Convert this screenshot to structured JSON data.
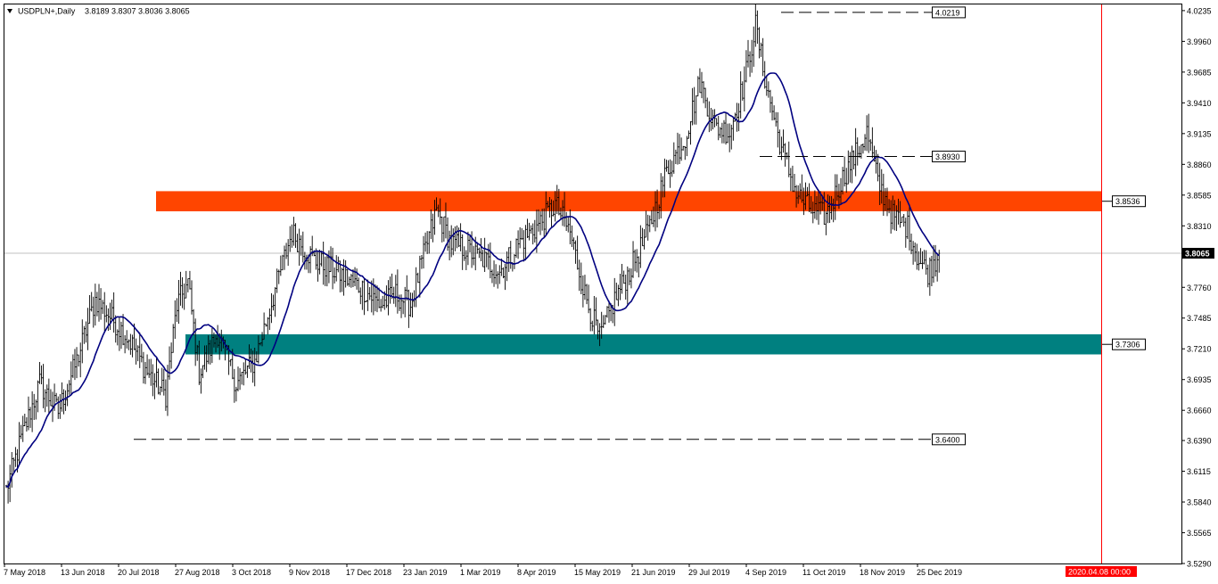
{
  "header": {
    "symbol": "USDPLN+,Daily",
    "ohlc": "3.8189 3.8307 3.8036 3.8065"
  },
  "chart_data": {
    "type": "candlestick-bar",
    "symbol": "USDPLN+",
    "timeframe": "Daily",
    "current_price": "3.8065",
    "time_marker": "2020.04.08 00:00",
    "y_ticks": [
      "4.0235",
      "3.9960",
      "3.9685",
      "3.9410",
      "3.9135",
      "3.8860",
      "3.8585",
      "3.8310",
      "3.8065",
      "3.7760",
      "3.7485",
      "3.7210",
      "3.6935",
      "3.6660",
      "3.6390",
      "3.6115",
      "3.5840",
      "3.5565",
      "3.5290"
    ],
    "x_ticks": [
      "7 May 2018",
      "13 Jun 2018",
      "20 Jul 2018",
      "27 Aug 2018",
      "3 Oct 2018",
      "9 Nov 2018",
      "17 Dec 2018",
      "23 Jan 2019",
      "1 Mar 2019",
      "8 Apr 2019",
      "15 May 2019",
      "21 Jun 2019",
      "29 Jul 2019",
      "4 Sep 2019",
      "11 Oct 2019",
      "18 Nov 2019",
      "25 Dec 2019"
    ],
    "ylim": [
      3.529,
      4.029
    ],
    "levels": [
      {
        "label": "4.0219",
        "value": 4.0219,
        "style": "dashed"
      },
      {
        "label": "3.8930",
        "value": 3.893,
        "style": "dashed"
      },
      {
        "label": "3.6400",
        "value": 3.64,
        "style": "dashed"
      }
    ],
    "zones": [
      {
        "label": "3.8536",
        "low": 3.844,
        "high": 3.862,
        "color": "#ff4500"
      },
      {
        "label": "3.7306",
        "low": 3.716,
        "high": 3.734,
        "color": "#008080"
      }
    ],
    "ma_color": "#000080",
    "price_path": [
      {
        "i": 0,
        "v": 3.595
      },
      {
        "i": 8,
        "v": 3.64
      },
      {
        "i": 18,
        "v": 3.69
      },
      {
        "i": 28,
        "v": 3.665
      },
      {
        "i": 38,
        "v": 3.71
      },
      {
        "i": 48,
        "v": 3.765
      },
      {
        "i": 56,
        "v": 3.75
      },
      {
        "i": 66,
        "v": 3.73
      },
      {
        "i": 76,
        "v": 3.7
      },
      {
        "i": 86,
        "v": 3.68
      },
      {
        "i": 92,
        "v": 3.76
      },
      {
        "i": 98,
        "v": 3.78
      },
      {
        "i": 104,
        "v": 3.7
      },
      {
        "i": 114,
        "v": 3.735
      },
      {
        "i": 124,
        "v": 3.69
      },
      {
        "i": 134,
        "v": 3.71
      },
      {
        "i": 146,
        "v": 3.78
      },
      {
        "i": 154,
        "v": 3.825
      },
      {
        "i": 166,
        "v": 3.8
      },
      {
        "i": 178,
        "v": 3.79
      },
      {
        "i": 192,
        "v": 3.775
      },
      {
        "i": 202,
        "v": 3.76
      },
      {
        "i": 210,
        "v": 3.77
      },
      {
        "i": 218,
        "v": 3.76
      },
      {
        "i": 226,
        "v": 3.81
      },
      {
        "i": 232,
        "v": 3.845
      },
      {
        "i": 240,
        "v": 3.815
      },
      {
        "i": 248,
        "v": 3.81
      },
      {
        "i": 258,
        "v": 3.8
      },
      {
        "i": 266,
        "v": 3.79
      },
      {
        "i": 276,
        "v": 3.815
      },
      {
        "i": 286,
        "v": 3.83
      },
      {
        "i": 296,
        "v": 3.85
      },
      {
        "i": 304,
        "v": 3.825
      },
      {
        "i": 312,
        "v": 3.77
      },
      {
        "i": 320,
        "v": 3.73
      },
      {
        "i": 328,
        "v": 3.765
      },
      {
        "i": 336,
        "v": 3.79
      },
      {
        "i": 346,
        "v": 3.825
      },
      {
        "i": 356,
        "v": 3.88
      },
      {
        "i": 366,
        "v": 3.91
      },
      {
        "i": 374,
        "v": 3.96
      },
      {
        "i": 382,
        "v": 3.92
      },
      {
        "i": 390,
        "v": 3.915
      },
      {
        "i": 398,
        "v": 3.96
      },
      {
        "i": 404,
        "v": 4.01
      },
      {
        "i": 410,
        "v": 3.955
      },
      {
        "i": 418,
        "v": 3.9
      },
      {
        "i": 426,
        "v": 3.86
      },
      {
        "i": 434,
        "v": 3.845
      },
      {
        "i": 442,
        "v": 3.84
      },
      {
        "i": 450,
        "v": 3.87
      },
      {
        "i": 458,
        "v": 3.895
      },
      {
        "i": 464,
        "v": 3.915
      },
      {
        "i": 470,
        "v": 3.87
      },
      {
        "i": 478,
        "v": 3.84
      },
      {
        "i": 486,
        "v": 3.83
      },
      {
        "i": 492,
        "v": 3.8
      },
      {
        "i": 497,
        "v": 3.79
      },
      {
        "i": 503,
        "v": 3.8065
      }
    ]
  }
}
